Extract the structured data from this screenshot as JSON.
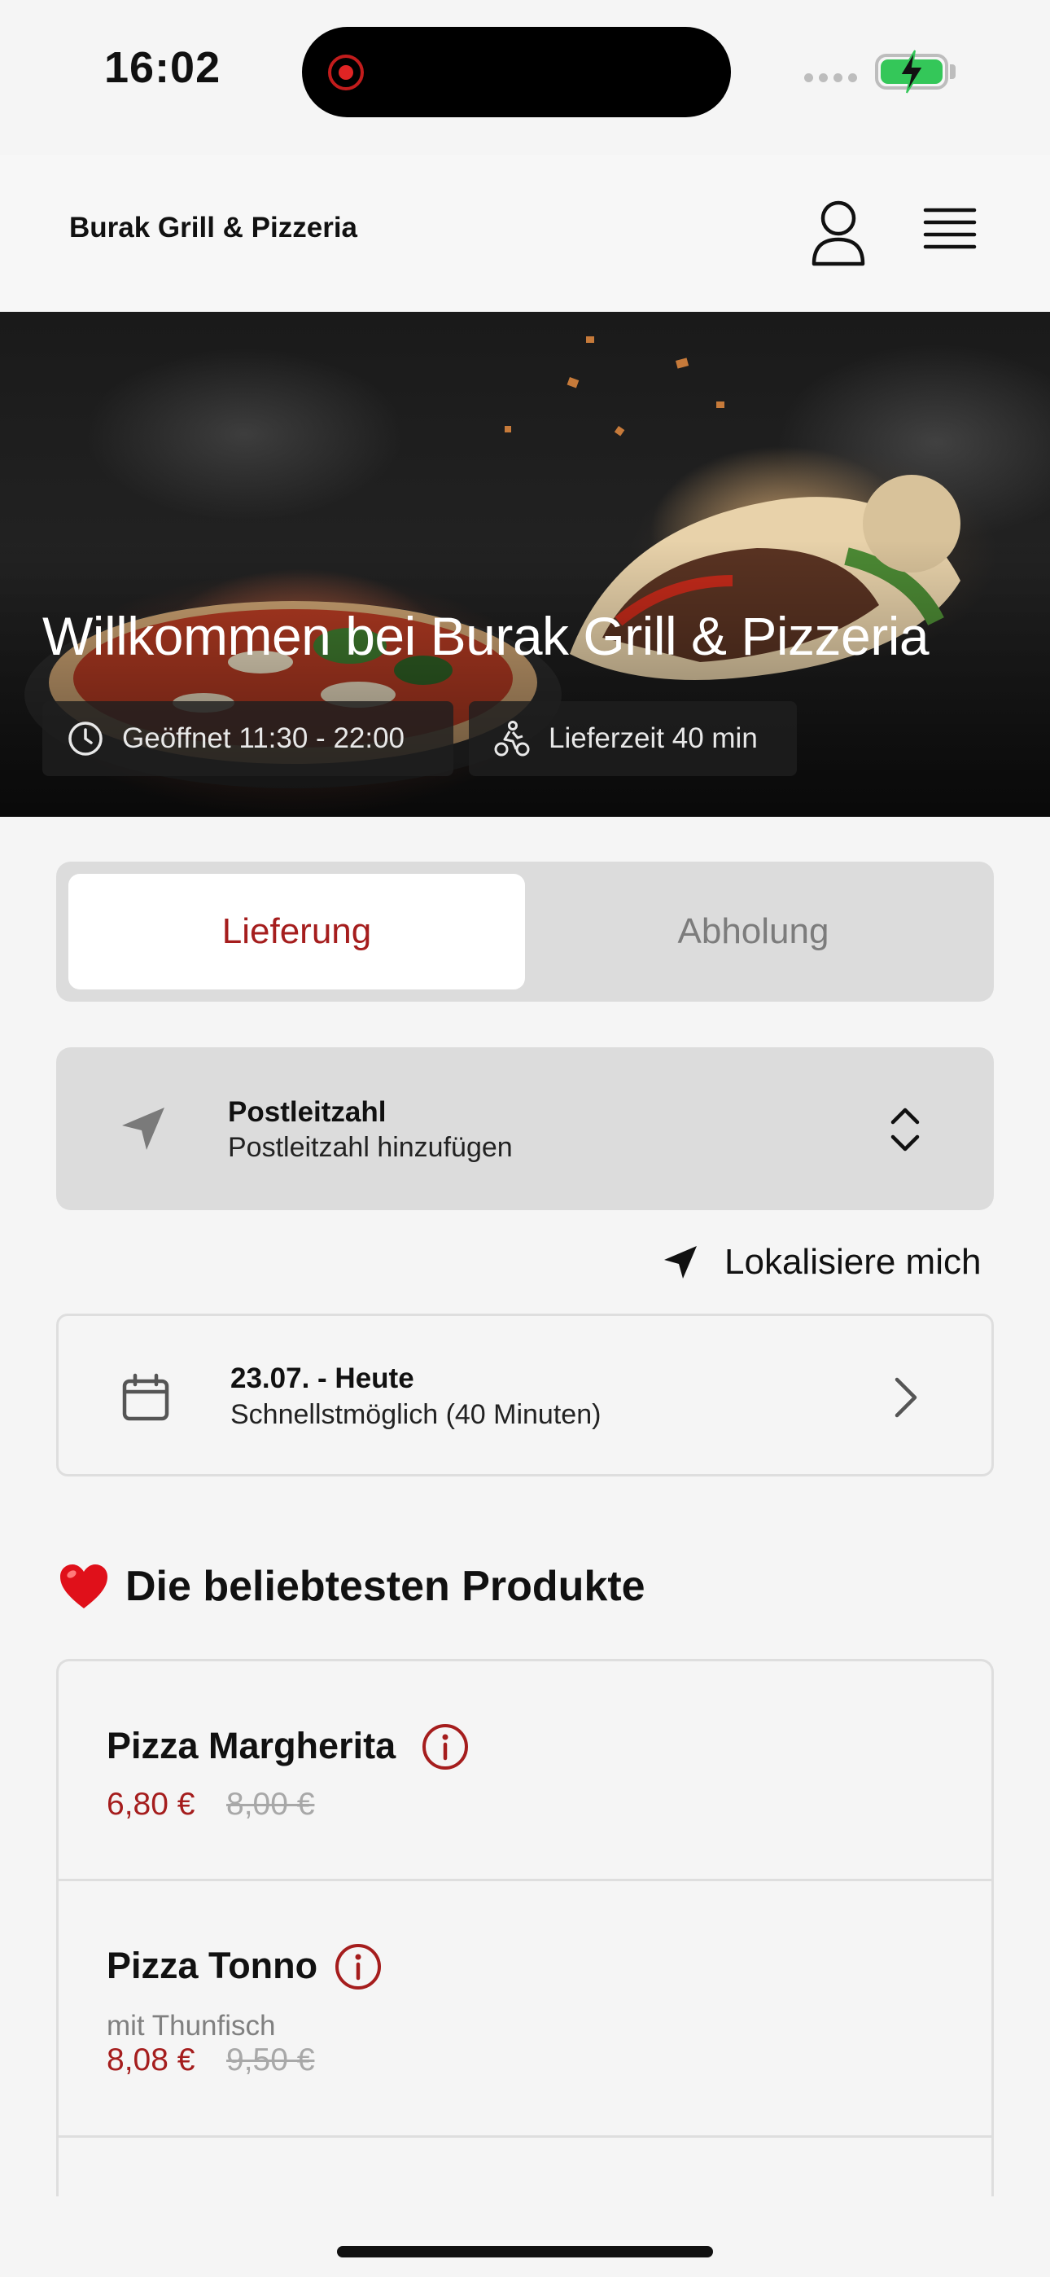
{
  "status_bar": {
    "time": "16:02",
    "icons": [
      "recording-indicator-icon",
      "cellular-signal-icon",
      "battery-charging-icon"
    ],
    "battery_color": "#34c759"
  },
  "header": {
    "brand": "Burak Grill & Pizzeria",
    "icons": [
      "user-icon",
      "hamburger-menu-icon"
    ]
  },
  "hero": {
    "title": "Willkommen bei Burak Grill & Pizzeria",
    "opening_hours": "Geöffnet 11:30 - 22:00",
    "delivery_time": "Lieferzeit 40 min"
  },
  "order_mode": {
    "options": [
      "Lieferung",
      "Abholung"
    ],
    "selected": "Lieferung"
  },
  "postcode": {
    "label": "Postleitzahl",
    "placeholder": "Postleitzahl hinzufügen"
  },
  "locate_me": "Lokalisiere mich",
  "delivery_date": {
    "title": "23.07. - Heute",
    "subtitle": "Schnellstmöglich (40 Minuten)"
  },
  "popular": {
    "heading": "Die beliebtesten Produkte",
    "products": [
      {
        "name": "Pizza Margherita",
        "description": "",
        "price": "6,80 €",
        "old_price": "8,00 €"
      },
      {
        "name": "Pizza Tonno",
        "description": "mit Thunfisch",
        "price": "8,08 €",
        "old_price": "9,50 €"
      }
    ]
  },
  "colors": {
    "accent": "#a51d1d",
    "background": "#f5f5f5",
    "panel": "#dcdcdc"
  }
}
